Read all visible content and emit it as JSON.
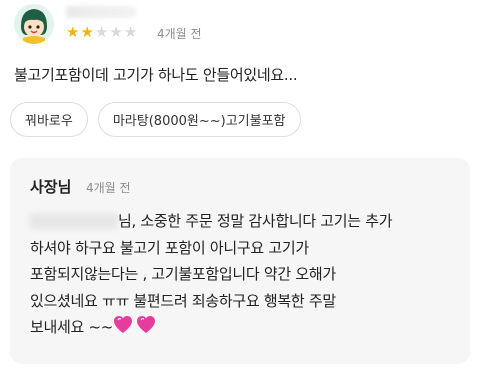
{
  "review": {
    "rating": 2,
    "max_rating": 5,
    "date": "4개월 전",
    "text": "불고기포함이데 고기가 하나도 안들어있네요..."
  },
  "tags": [
    "꿔바로우",
    "마라탕(8000원~~)고기불포함"
  ],
  "reply": {
    "author": "사장님",
    "date": "4개월 전",
    "lines": [
      "님, 소중한 주문 정말 감사합니다  고기는 추가",
      "하셔야 하구요 불고기 포함이 아니구요 고기가",
      "포함되지않는다는 , 고기불포함입니다 약간 오해가",
      "있으셨네요 ㅠㅠ 불편드려 죄송하구요 행복한 주말",
      "보내세요 ~~"
    ]
  },
  "icons": {
    "avatar": "girl-character-avatar",
    "star": "star-icon",
    "heart": "sparkling-heart-icon"
  },
  "colors": {
    "star_filled": "#f2b316",
    "star_empty": "#d9d9d9",
    "heart": "#e63d9c",
    "reply_bg": "#f6f6f6"
  }
}
